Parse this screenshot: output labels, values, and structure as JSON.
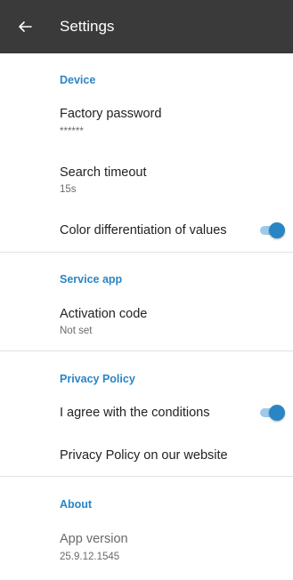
{
  "toolbar": {
    "title": "Settings",
    "back_icon": "arrow-left-icon",
    "background": "#3a3a3a"
  },
  "colors": {
    "accent": "#2a85c4",
    "switch_track": "#9ccaec",
    "title_text": "#222222",
    "summary_text": "#6a6a6a"
  },
  "sections": {
    "device": {
      "header": "Device",
      "factory_password": {
        "title": "Factory password",
        "summary": "******"
      },
      "search_timeout": {
        "title": "Search timeout",
        "summary": "15s"
      },
      "color_diff": {
        "title": "Color differentiation of values",
        "enabled": true
      }
    },
    "service_app": {
      "header": "Service app",
      "activation_code": {
        "title": "Activation code",
        "summary": "Not set"
      }
    },
    "privacy_policy": {
      "header": "Privacy Policy",
      "agree": {
        "title": "I agree with the conditions",
        "enabled": true
      },
      "website": {
        "title": "Privacy Policy on our website"
      }
    },
    "about": {
      "header": "About",
      "app_version": {
        "title": "App version",
        "summary": "25.9.12.1545"
      }
    }
  }
}
